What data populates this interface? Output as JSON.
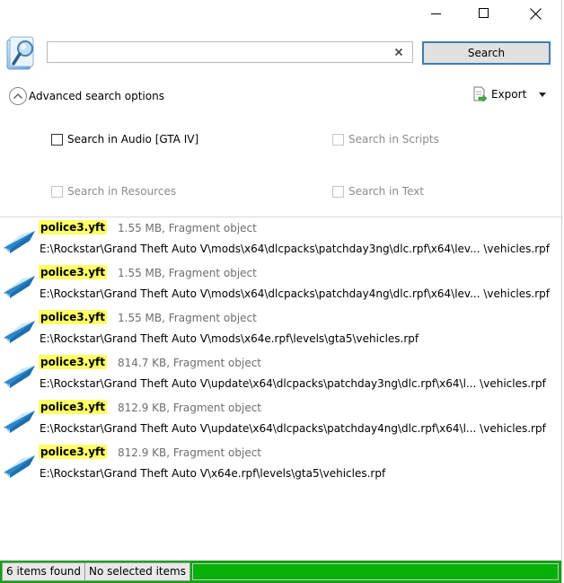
{
  "window": {
    "controls": [
      "minimize",
      "maximize",
      "close"
    ]
  },
  "search": {
    "value": "",
    "placeholder": "",
    "button_label": "Search"
  },
  "advanced": {
    "toggle_label": "Advanced search options",
    "export_label": "Export",
    "options": [
      {
        "label": "Search in Audio [GTA IV]",
        "checked": false,
        "enabled": true
      },
      {
        "label": "Search in Scripts",
        "checked": false,
        "enabled": false
      },
      {
        "label": "Search in Resources",
        "checked": false,
        "enabled": false
      },
      {
        "label": "Search in Text",
        "checked": false,
        "enabled": false
      }
    ]
  },
  "results": [
    {
      "name": "police3.yft",
      "meta": "1.55 MB, Fragment object",
      "path": "E:\\Rockstar\\Grand Theft Auto V\\mods\\x64\\dlcpacks\\patchday3ng\\dlc.rpf\\x64\\lev... \\vehicles.rpf",
      "icon": "fragment-object-icon"
    },
    {
      "name": "police3.yft",
      "meta": "1.55 MB, Fragment object",
      "path": "E:\\Rockstar\\Grand Theft Auto V\\mods\\x64\\dlcpacks\\patchday4ng\\dlc.rpf\\x64\\lev... \\vehicles.rpf",
      "icon": "fragment-object-icon"
    },
    {
      "name": "police3.yft",
      "meta": "1.55 MB, Fragment object",
      "path": "E:\\Rockstar\\Grand Theft Auto V\\mods\\x64e.rpf\\levels\\gta5\\vehicles.rpf",
      "icon": "fragment-object-icon"
    },
    {
      "name": "police3.yft",
      "meta": "814.7 KB, Fragment object",
      "path": "E:\\Rockstar\\Grand Theft Auto V\\update\\x64\\dlcpacks\\patchday3ng\\dlc.rpf\\x64\\l... \\vehicles.rpf",
      "icon": "fragment-object-icon"
    },
    {
      "name": "police3.yft",
      "meta": "812.9 KB, Fragment object",
      "path": "E:\\Rockstar\\Grand Theft Auto V\\update\\x64\\dlcpacks\\patchday4ng\\dlc.rpf\\x64\\l... \\vehicles.rpf",
      "icon": "fragment-object-icon"
    },
    {
      "name": "police3.yft",
      "meta": "812.9 KB, Fragment object",
      "path": "E:\\Rockstar\\Grand Theft Auto V\\x64e.rpf\\levels\\gta5\\vehicles.rpf",
      "icon": "fragment-object-icon"
    }
  ],
  "status": {
    "count_label": "6 items found",
    "selection_label": "No selected items",
    "progress": 1.0,
    "progress_color": "#06b006"
  },
  "colors": {
    "highlight": "#ffff66",
    "accent": "#3c7fb1",
    "status_bar": "#0aa50a"
  }
}
